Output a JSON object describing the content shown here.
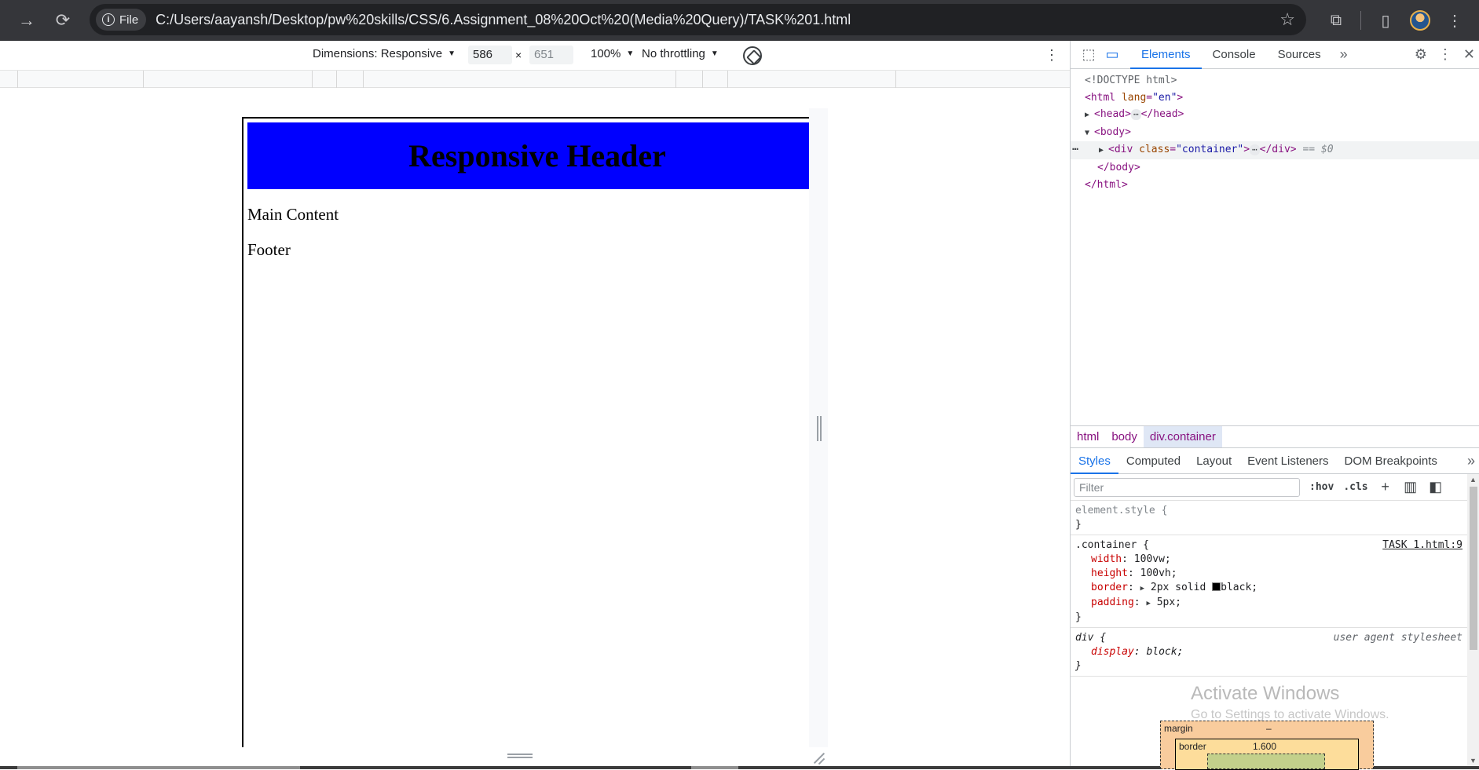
{
  "browser": {
    "site_chip": "File",
    "url": "C:/Users/aayansh/Desktop/pw%20skills/CSS/6.Assignment_08%20Oct%20(Media%20Query)/TASK%201.html"
  },
  "device_toolbar": {
    "dimensions": "Dimensions: Responsive",
    "width": "586",
    "height": "651",
    "zoom": "100%",
    "throttling": "No throttling"
  },
  "page": {
    "header": "Responsive Header",
    "content": "Main Content",
    "footer": "Footer"
  },
  "devtools": {
    "tabs": [
      "Elements",
      "Console",
      "Sources"
    ],
    "dom": {
      "doctype": "<!DOCTYPE html>",
      "html_open_tag": "<html",
      "html_attr": "lang",
      "html_attr_val": "\"en\"",
      "html_open_close": ">",
      "head_open": "<head>",
      "head_close": "</head>",
      "body_open": "<body>",
      "div_open": "<div",
      "div_attr": "class",
      "div_attr_val": "\"container\"",
      "div_open_close": ">",
      "div_close": "</div>",
      "sel_marker": "== $0",
      "body_close": "</body>",
      "html_close": "</html>",
      "ellipsis": "⋯"
    },
    "breadcrumbs": [
      "html",
      "body",
      "div.container"
    ],
    "style_tabs": [
      "Styles",
      "Computed",
      "Layout",
      "Event Listeners",
      "DOM Breakpoints"
    ],
    "filter_placeholder": "Filter",
    "hov": ":hov",
    "cls": ".cls",
    "rules": {
      "element_style": "element.style {",
      "close_brace": "}",
      "container_selector": ".container {",
      "container_source": "TASK 1.html:9",
      "width_prop": "width",
      "width_val": "100vw;",
      "height_prop": "height",
      "height_val": "100vh;",
      "border_prop": "border",
      "border_val_a": "2px solid",
      "border_val_b": "black;",
      "padding_prop": "padding",
      "padding_val": "5px;",
      "div_selector": "div {",
      "ua_label": "user agent stylesheet",
      "display_prop": "display",
      "display_val": "block;"
    },
    "watermark_title": "Activate Windows",
    "watermark_sub": "Go to Settings to activate Windows.",
    "box_model": {
      "margin_label": "margin",
      "margin_value": "–",
      "border_label": "border",
      "border_value": "1.600"
    }
  },
  "colors": {
    "header_bg": "#0000ff",
    "accent": "#1a73e8",
    "chrome_bg": "#35363a"
  }
}
